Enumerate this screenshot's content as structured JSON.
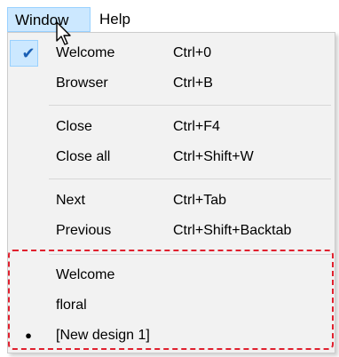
{
  "menubar": {
    "window_label": "Window",
    "help_label": "Help"
  },
  "menu": {
    "items": [
      {
        "label": "Welcome",
        "shortcut": "Ctrl+0",
        "mark": "✔"
      },
      {
        "label": "Browser",
        "shortcut": "Ctrl+B",
        "mark": ""
      },
      {
        "label": "Close",
        "shortcut": "Ctrl+F4",
        "mark": ""
      },
      {
        "label": "Close all",
        "shortcut": "Ctrl+Shift+W",
        "mark": ""
      },
      {
        "label": "Next",
        "shortcut": "Ctrl+Tab",
        "mark": ""
      },
      {
        "label": "Previous",
        "shortcut": "Ctrl+Shift+Backtab",
        "mark": ""
      },
      {
        "label": "Welcome",
        "shortcut": "",
        "mark": ""
      },
      {
        "label": "floral",
        "shortcut": "",
        "mark": ""
      },
      {
        "label": "[New design 1]",
        "shortcut": "",
        "mark": "●"
      }
    ]
  },
  "colors": {
    "hover_fill": "#cce8ff",
    "hover_border": "#99d1ff",
    "menu_bg": "#f2f2f2",
    "annotation": "#e0202e"
  },
  "icons": {
    "check": "check-icon",
    "bullet": "radio-bullet-icon",
    "cursor": "mouse-pointer-icon"
  }
}
